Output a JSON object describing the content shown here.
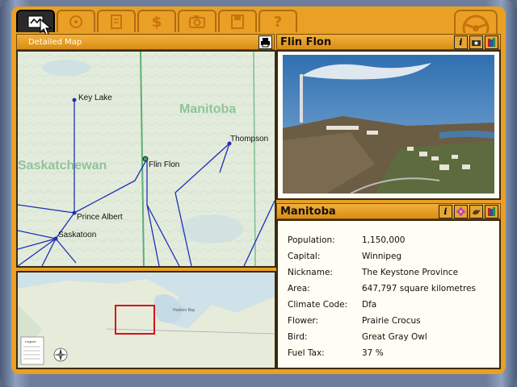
{
  "detail_map": {
    "header": "Detailed Map",
    "provinces": [
      "Manitoba",
      "Saskatchewan"
    ],
    "cities": [
      "Key Lake",
      "Thompson",
      "Flin Flon",
      "Prince Albert",
      "Saskatoon"
    ]
  },
  "photo_panel": {
    "title": "Flin Flon"
  },
  "info_panel": {
    "title": "Manitoba",
    "rows": [
      {
        "label": "Population:",
        "value": "1,150,000"
      },
      {
        "label": "Capital:",
        "value": "Winnipeg"
      },
      {
        "label": "Nickname:",
        "value": "The Keystone Province"
      },
      {
        "label": "Area:",
        "value": "647,797 square kilometres"
      },
      {
        "label": "Climate Code:",
        "value": "Dfa"
      },
      {
        "label": "Flower:",
        "value": "Prairie Crocus"
      },
      {
        "label": "Bird:",
        "value": "Great Gray Owl"
      },
      {
        "label": "Fuel Tax:",
        "value": "37 %"
      }
    ]
  },
  "overview_map": {
    "labels": [
      "Hudson Bay",
      "Legend"
    ]
  },
  "tabs": [
    "map-tab",
    "travel-log-tab",
    "clipboard-tab",
    "money-tab",
    "camera-tab",
    "save-tab",
    "help-tab"
  ],
  "colors": {
    "accent": "#e9a024",
    "border": "#3a2a10",
    "road": "#1f2fb8",
    "border_line": "#3aa060"
  }
}
